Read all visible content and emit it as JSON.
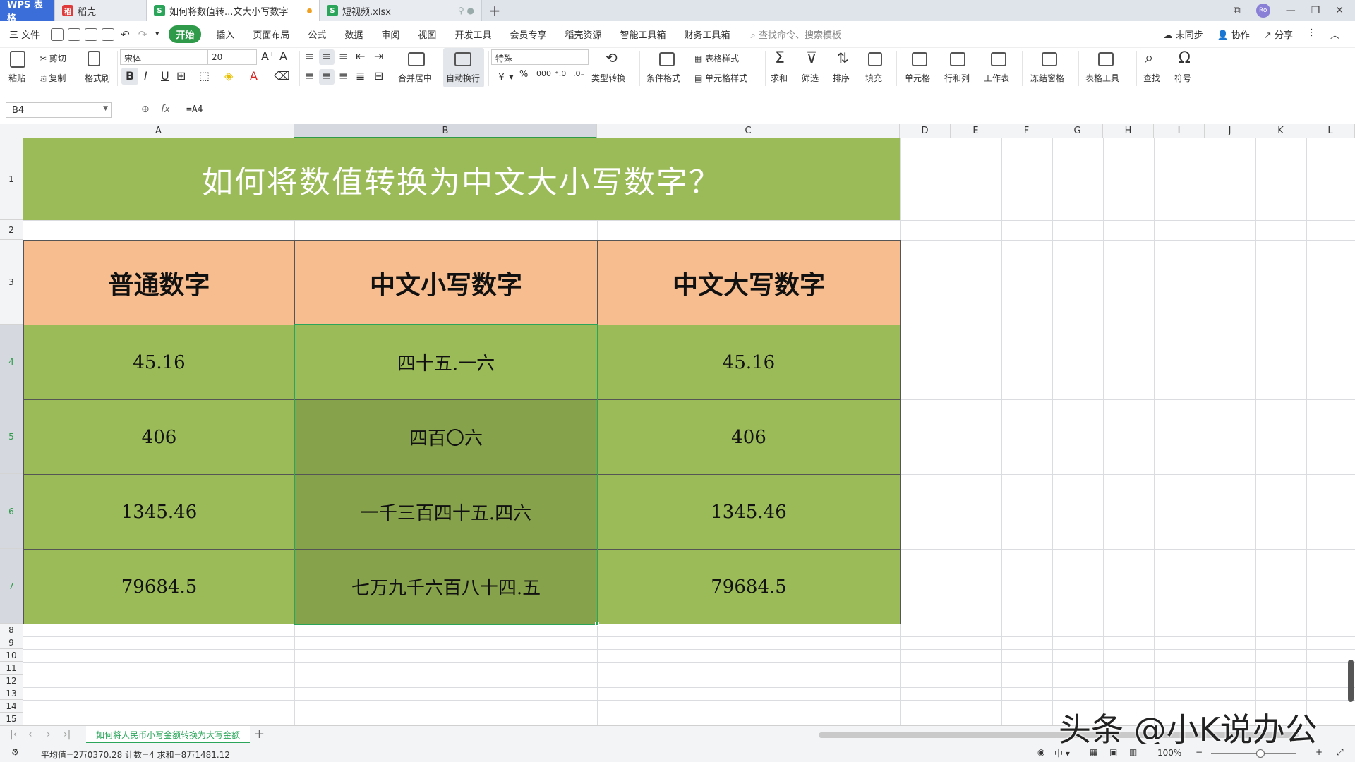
{
  "tabs": {
    "app": "WPS 表格",
    "tab1": "稻壳",
    "active": "如何将数值转...文大小写数字",
    "tab3": "短视频.xlsx"
  },
  "menu": {
    "file": "三 文件",
    "items": [
      "开始",
      "插入",
      "页面布局",
      "公式",
      "数据",
      "审阅",
      "视图",
      "开发工具",
      "会员专享",
      "稻壳资源",
      "智能工具箱",
      "财务工具箱"
    ],
    "search": "查找命令、搜索模板",
    "right": [
      "未同步",
      "协作",
      "分享"
    ]
  },
  "ribbon": {
    "paste": "粘贴",
    "cut": "剪切",
    "copy": "复制",
    "format_painter": "格式刷",
    "font_name": "宋体",
    "font_size": "20",
    "merge_center": "合并居中",
    "wrap_text": "自动换行",
    "number_format": "特殊",
    "type_convert": "类型转换",
    "cond_format": "条件格式",
    "table_style": "表格样式",
    "cell_style": "单元格样式",
    "sum": "求和",
    "filter": "筛选",
    "sort": "排序",
    "fill": "填充",
    "cell": "单元格",
    "row_col": "行和列",
    "worksheet": "工作表",
    "freeze": "冻结窗格",
    "table_tools": "表格工具",
    "find": "查找",
    "symbol": "符号"
  },
  "formula_bar": {
    "name_box": "B4",
    "fx": "fx",
    "formula": "=A4"
  },
  "columns": [
    "A",
    "B",
    "C",
    "D",
    "E",
    "F",
    "G",
    "H",
    "I",
    "J",
    "K",
    "L"
  ],
  "rows": [
    "1",
    "2",
    "3",
    "4",
    "5",
    "6",
    "7",
    "8",
    "9",
    "10",
    "11",
    "12",
    "13",
    "14",
    "15"
  ],
  "sheet": {
    "title": "如何将数值转换为中文大小写数字？",
    "headers": [
      "普通数字",
      "中文小写数字",
      "中文大写数字"
    ],
    "data": [
      [
        "45.16",
        "四十五.一六",
        "45.16"
      ],
      [
        "406",
        "四百〇六",
        "406"
      ],
      [
        "1345.46",
        "一千三百四十五.四六",
        "1345.46"
      ],
      [
        "79684.5",
        "七万九千六百八十四.五",
        "79684.5"
      ]
    ]
  },
  "sheet_tab": "如何将人民币小写金额转换为大写金额",
  "status": {
    "summary": "平均值=2万0370.28  计数=4  求和=8万1481.12",
    "zoom": "100%"
  },
  "watermark": "头条 @小K说办公",
  "colors": {
    "green_fill": "#9bbb59",
    "dark_green_fill": "#86a24b",
    "header_fill": "#f8bd8f",
    "accent": "#2f9b4a"
  }
}
